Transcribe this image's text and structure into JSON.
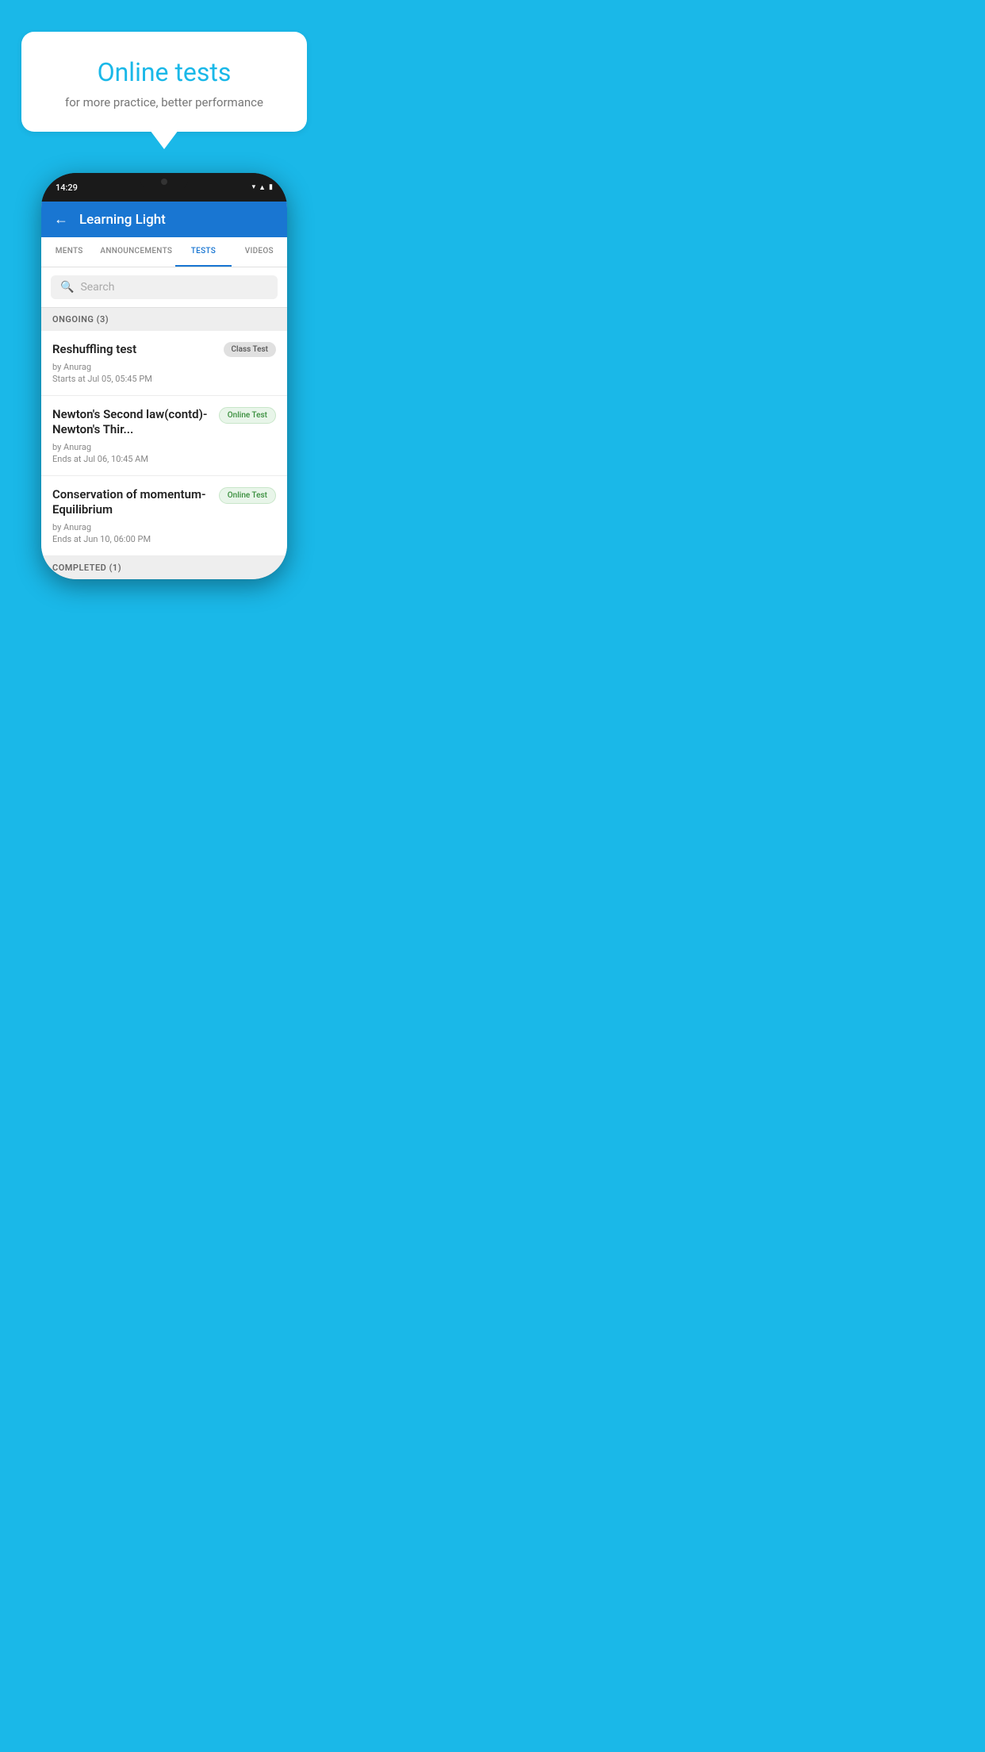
{
  "background_color": "#1ab8e8",
  "hero": {
    "title": "Online tests",
    "subtitle": "for more practice, better performance"
  },
  "phone": {
    "status_time": "14:29",
    "app_title": "Learning Light",
    "tabs": [
      {
        "label": "MENTS",
        "active": false
      },
      {
        "label": "ANNOUNCEMENTS",
        "active": false
      },
      {
        "label": "TESTS",
        "active": true
      },
      {
        "label": "VIDEOS",
        "active": false
      }
    ],
    "search": {
      "placeholder": "Search"
    },
    "ongoing_label": "ONGOING (3)",
    "tests": [
      {
        "name": "Reshuffling test",
        "badge": "Class Test",
        "badge_type": "class",
        "author": "by Anurag",
        "date": "Starts at  Jul 05, 05:45 PM"
      },
      {
        "name": "Newton's Second law(contd)-Newton's Thir...",
        "badge": "Online Test",
        "badge_type": "online",
        "author": "by Anurag",
        "date": "Ends at  Jul 06, 10:45 AM"
      },
      {
        "name": "Conservation of momentum-Equilibrium",
        "badge": "Online Test",
        "badge_type": "online",
        "author": "by Anurag",
        "date": "Ends at  Jun 10, 06:00 PM"
      }
    ],
    "completed_label": "COMPLETED (1)"
  }
}
